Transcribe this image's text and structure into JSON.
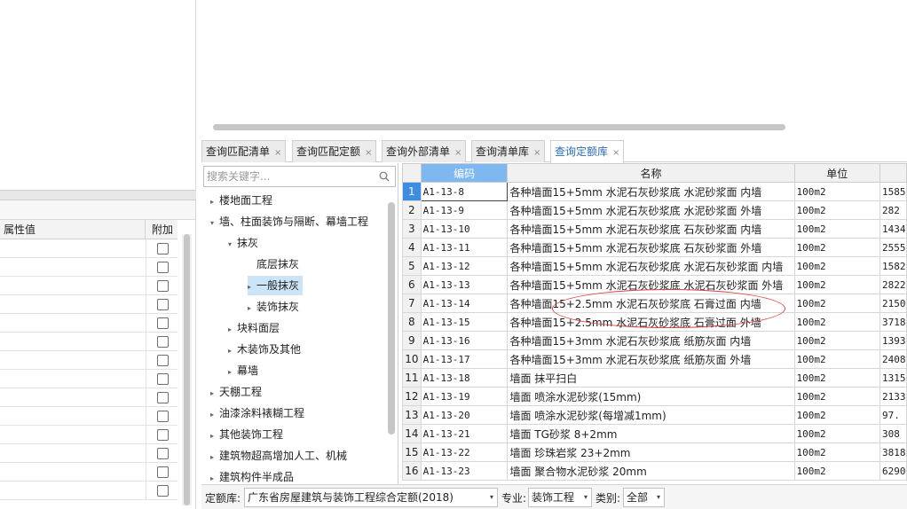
{
  "left_grid": {
    "col_value": "属性值",
    "col_extra": "附加",
    "rows": 14
  },
  "tabs": [
    {
      "label": "查询匹配清单",
      "active": false
    },
    {
      "label": "查询匹配定额",
      "active": false
    },
    {
      "label": "查询外部清单",
      "active": false
    },
    {
      "label": "查询清单库",
      "active": false
    },
    {
      "label": "查询定额库",
      "active": true
    }
  ],
  "tab_close_glyph": "×",
  "search": {
    "placeholder": "搜索关键字..."
  },
  "tree": [
    {
      "label": "楼地面工程",
      "level": 0,
      "arrow": "right"
    },
    {
      "label": "墙、柱面装饰与隔断、幕墙工程",
      "level": 0,
      "arrow": "down"
    },
    {
      "label": "抹灰",
      "level": 1,
      "arrow": "down"
    },
    {
      "label": "底层抹灰",
      "level": 2,
      "arrow": "none"
    },
    {
      "label": "一般抹灰",
      "level": 2,
      "arrow": "right",
      "selected": true
    },
    {
      "label": "装饰抹灰",
      "level": 2,
      "arrow": "right"
    },
    {
      "label": "块料面层",
      "level": 1,
      "arrow": "right"
    },
    {
      "label": "木装饰及其他",
      "level": 1,
      "arrow": "right"
    },
    {
      "label": "幕墙",
      "level": 1,
      "arrow": "right"
    },
    {
      "label": "天棚工程",
      "level": 0,
      "arrow": "right"
    },
    {
      "label": "油漆涂料裱糊工程",
      "level": 0,
      "arrow": "right"
    },
    {
      "label": "其他装饰工程",
      "level": 0,
      "arrow": "right"
    },
    {
      "label": "建筑物超高增加人工、机械",
      "level": 0,
      "arrow": "right"
    },
    {
      "label": "建筑构件半成品",
      "level": 0,
      "arrow": "right"
    }
  ],
  "grid": {
    "headers": {
      "code": "编码",
      "name": "名称",
      "unit": "单位",
      "price": ""
    },
    "rows": [
      {
        "idx": "1",
        "code": "A1-13-8",
        "name": "各种墙面15+5mm 水泥石灰砂浆底 水泥砂浆面 内墙",
        "unit": "100m2",
        "price": "1585"
      },
      {
        "idx": "2",
        "code": "A1-13-9",
        "name": "各种墙面15+5mm 水泥石灰砂浆底 水泥砂浆面 外墙",
        "unit": "100m2",
        "price": "282"
      },
      {
        "idx": "3",
        "code": "A1-13-10",
        "name": "各种墙面15+5mm 水泥石灰砂浆底 石灰砂浆面 内墙",
        "unit": "100m2",
        "price": "1434"
      },
      {
        "idx": "4",
        "code": "A1-13-11",
        "name": "各种墙面15+5mm 水泥石灰砂浆底 石灰砂浆面 外墙",
        "unit": "100m2",
        "price": "2555"
      },
      {
        "idx": "5",
        "code": "A1-13-12",
        "name": "各种墙面15+5mm 水泥石灰砂浆底 水泥石灰砂浆面 内墙",
        "unit": "100m2",
        "price": "1582"
      },
      {
        "idx": "6",
        "code": "A1-13-13",
        "name": "各种墙面15+5mm 水泥石灰砂浆底 水泥石灰砂浆面 外墙",
        "unit": "100m2",
        "price": "2822"
      },
      {
        "idx": "7",
        "code": "A1-13-14",
        "name": "各种墙面15+2.5mm 水泥石灰砂浆底 石膏过面 内墙",
        "unit": "100m2",
        "price": "2150"
      },
      {
        "idx": "8",
        "code": "A1-13-15",
        "name": "各种墙面15+2.5mm 水泥石灰砂浆底 石膏过面 外墙",
        "unit": "100m2",
        "price": "3718"
      },
      {
        "idx": "9",
        "code": "A1-13-16",
        "name": "各种墙面15+3mm 水泥石灰砂浆底 纸筋灰面 内墙",
        "unit": "100m2",
        "price": "1393"
      },
      {
        "idx": "10",
        "code": "A1-13-17",
        "name": "各种墙面15+3mm 水泥石灰砂浆底 纸筋灰面 外墙",
        "unit": "100m2",
        "price": "2408"
      },
      {
        "idx": "11",
        "code": "A1-13-18",
        "name": "墙面 抹平扫白",
        "unit": "100m2",
        "price": "1315"
      },
      {
        "idx": "12",
        "code": "A1-13-19",
        "name": "墙面 喷涂水泥砂浆(15mm)",
        "unit": "100m2",
        "price": "2133"
      },
      {
        "idx": "13",
        "code": "A1-13-20",
        "name": "墙面 喷涂水泥砂浆(每增减1mm)",
        "unit": "100m2",
        "price": "97."
      },
      {
        "idx": "14",
        "code": "A1-13-21",
        "name": "墙面 TG砂浆 8+2mm",
        "unit": "100m2",
        "price": "308"
      },
      {
        "idx": "15",
        "code": "A1-13-22",
        "name": "墙面 珍珠岩浆 23+2mm",
        "unit": "100m2",
        "price": "3818"
      },
      {
        "idx": "16",
        "code": "A1-13-23",
        "name": "墙面 聚合物水泥砂浆 20mm",
        "unit": "100m2",
        "price": "6290"
      }
    ]
  },
  "bottom": {
    "library_label": "定额库:",
    "library_value": "广东省房屋建筑与装饰工程综合定额(2018)",
    "major_label": "专业:",
    "major_value": "装饰工程",
    "category_label": "类别:",
    "category_value": "全部",
    "caret": "▾"
  }
}
